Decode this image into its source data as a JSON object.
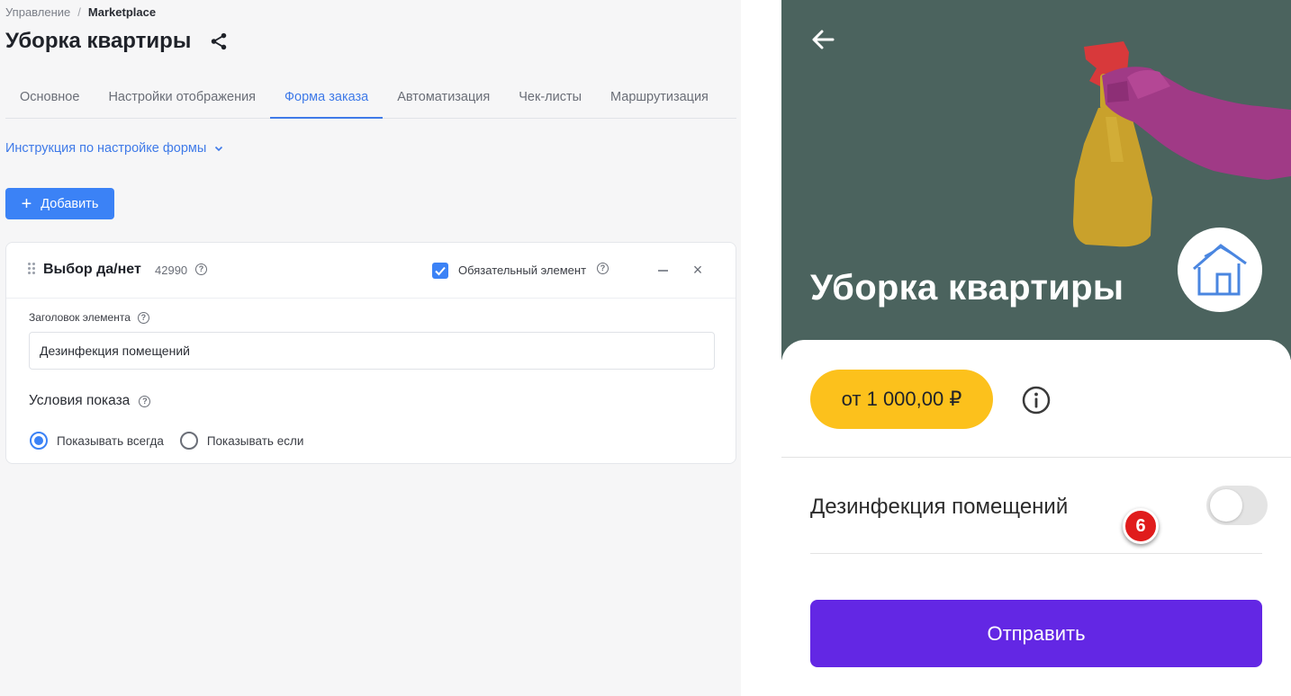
{
  "breadcrumb": {
    "parent": "Управление",
    "separator": "/",
    "current": "Marketplace"
  },
  "page": {
    "title": "Уборка квартиры"
  },
  "tabs": [
    {
      "label": "Основное"
    },
    {
      "label": "Настройки отображения"
    },
    {
      "label": "Форма заказа",
      "active": true
    },
    {
      "label": "Автоматизация"
    },
    {
      "label": "Чек-листы"
    },
    {
      "label": "Маршрутизация"
    }
  ],
  "instructions": {
    "label": "Инструкция по настройке формы"
  },
  "add_button": {
    "icon": "+",
    "label": "Добавить"
  },
  "element_card": {
    "title": "Выбор да/нет",
    "id": "42990",
    "help_glyph": "?",
    "required_label": "Обязательный элемент",
    "required_checked": true,
    "close_glyph": "×",
    "field_label": "Заголовок элемента",
    "field_value": "Дезинфекция помещений",
    "conditions_title": "Условия показа",
    "radio_always": "Показывать всегда",
    "radio_if": "Показывать если",
    "selected_radio": "always"
  },
  "preview": {
    "title": "Уборка квартиры",
    "price": "от 1 000,00 ₽",
    "option_label": "Дезинфекция помещений",
    "option_enabled": false,
    "marker": "6",
    "submit_label": "Отправить",
    "colors": {
      "hero_bg": "#4b635e",
      "price_bg": "#fcc11c",
      "submit_bg": "#6327e4",
      "marker_bg": "#e01c1c",
      "accent": "#3b82f6"
    }
  }
}
